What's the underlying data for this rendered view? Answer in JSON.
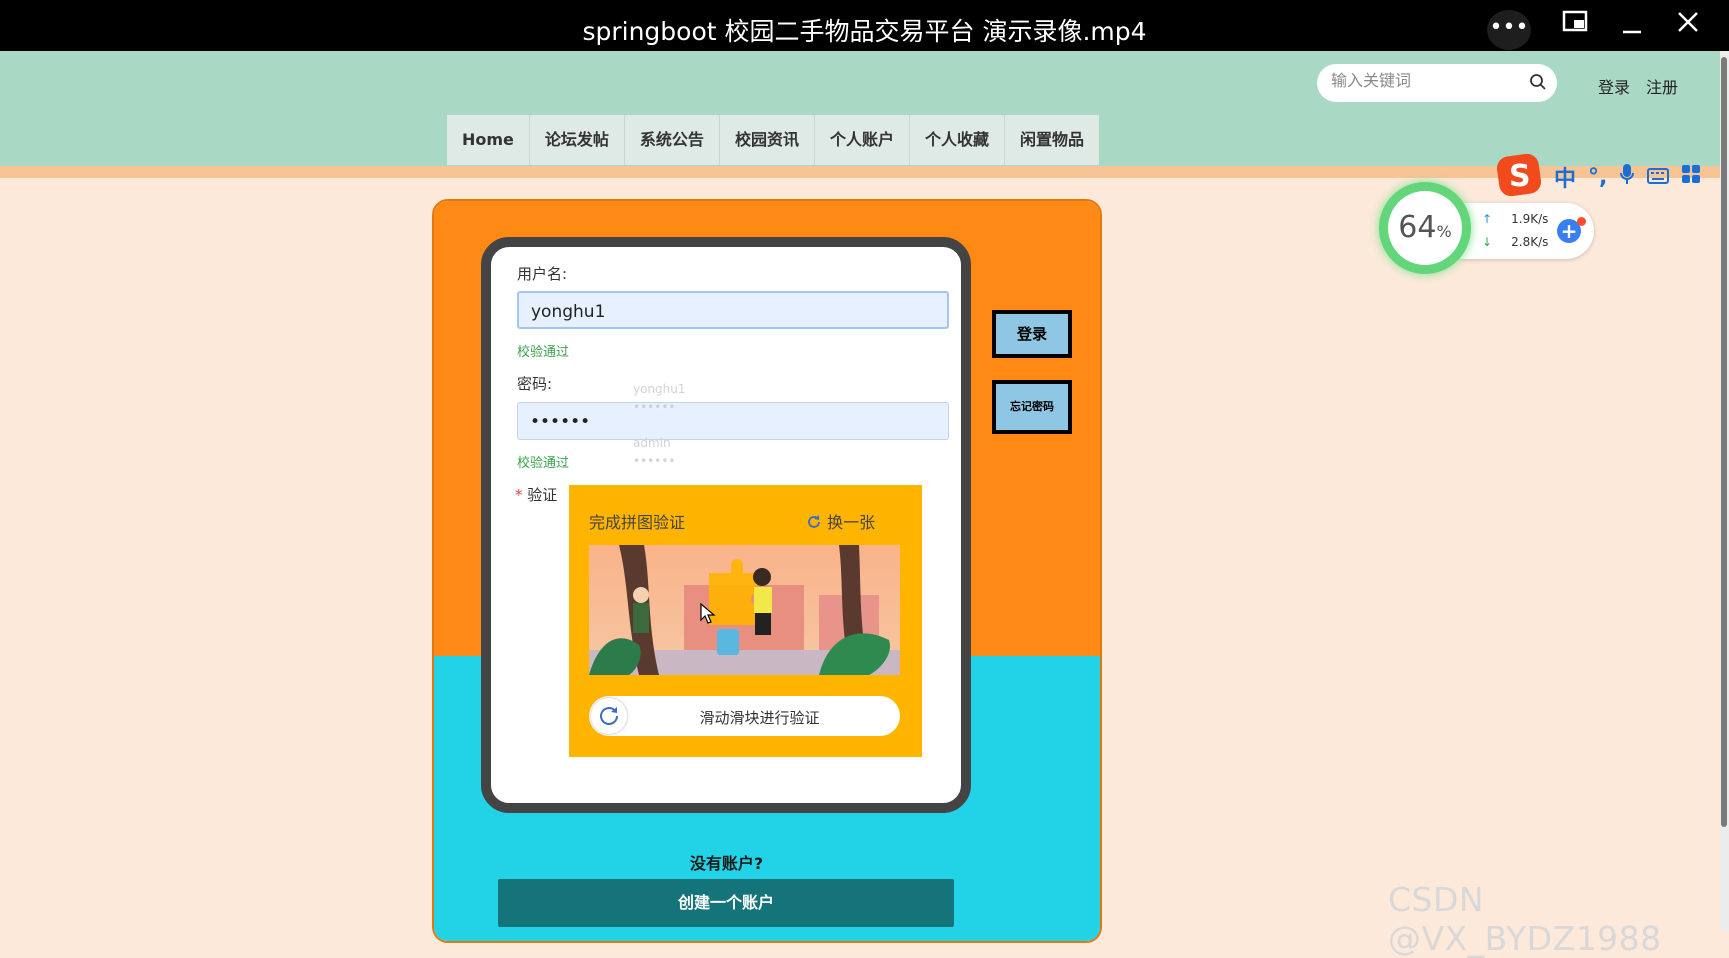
{
  "window": {
    "title": "springboot 校园二手物品交易平台 演示录像.mp4"
  },
  "header": {
    "search_placeholder": "输入关键词",
    "login_label": "登录",
    "register_label": "注册",
    "nav": [
      "Home",
      "论坛发帖",
      "系统公告",
      "校园资讯",
      "个人账户",
      "个人收藏",
      "闲置物品"
    ]
  },
  "form": {
    "username_label": "用户名:",
    "username_value": "yonghu1",
    "username_valid": "校验通过",
    "password_label": "密码:",
    "password_value": "••••••",
    "password_valid": "校验通过",
    "verify_label": "验证",
    "required_mark": "*",
    "autofill": [
      "yonghu1",
      "••••••",
      "admin",
      "••••••"
    ]
  },
  "captcha": {
    "title": "完成拼图验证",
    "refresh_label": "换一张",
    "slider_text": "滑动滑块进行验证"
  },
  "side_buttons": {
    "login": "登录",
    "forgot": "忘记密码"
  },
  "signup": {
    "prompt": "没有账户?",
    "button": "创建一个账户"
  },
  "system": {
    "ime_mode": "中",
    "cpu_percent": "64",
    "percent_sign": "%",
    "upload_speed": "1.9K/s",
    "download_speed": "2.8K/s"
  },
  "watermark": "CSDN @VX_BYDZ1988",
  "colors": {
    "header_bg": "#a9d9c4",
    "page_bg": "#fde9da",
    "panel_top": "#fe8914",
    "panel_bottom": "#22d3e8",
    "captcha_bg": "#ffb400",
    "create_button": "#147479"
  }
}
